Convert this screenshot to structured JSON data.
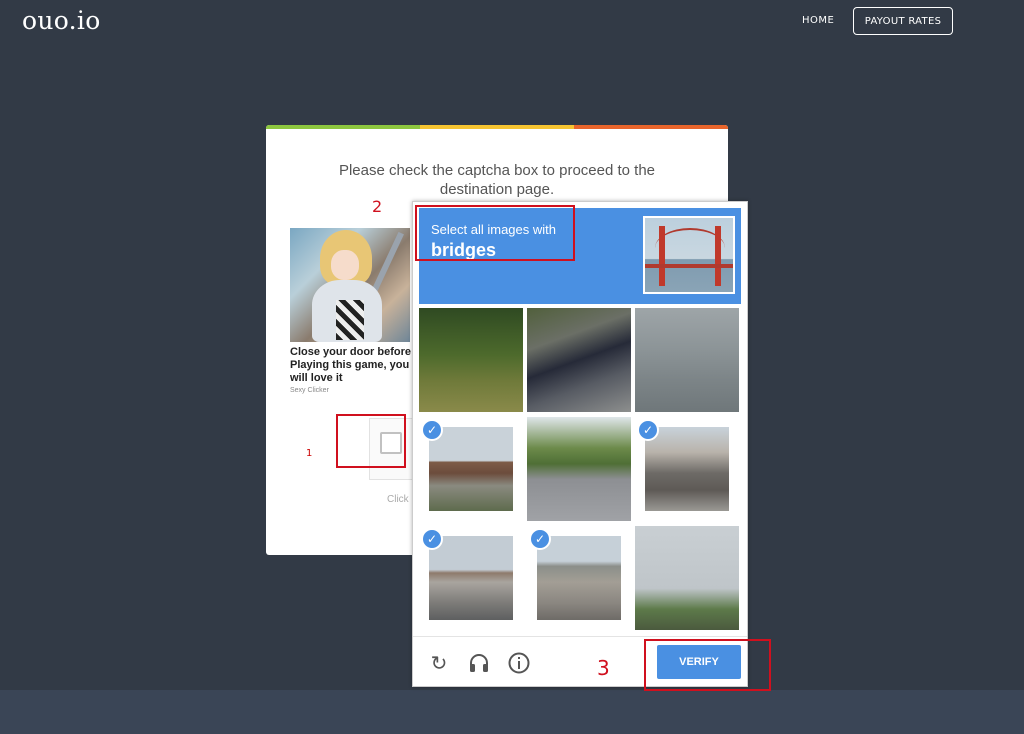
{
  "header": {
    "logo": "ouo.io",
    "nav": {
      "home": "HOME",
      "payout_rates": "PAYOUT RATES"
    }
  },
  "card": {
    "title": "Please check the captcha box to proceed to the destination page.",
    "top_bar_colors": [
      "#8dc63f",
      "#f6c431",
      "#e9652c"
    ],
    "ad": {
      "caption": "Close your door before Playing this game, you will love it",
      "source": "Sexy Clicker"
    },
    "click_hint": "Click"
  },
  "annotations": {
    "one": "1",
    "two": "2",
    "three": "3"
  },
  "captcha": {
    "prompt_prefix": "Select all images with",
    "prompt_object": "bridges",
    "tiles": [
      {
        "selected": false
      },
      {
        "selected": false
      },
      {
        "selected": false
      },
      {
        "selected": true
      },
      {
        "selected": false
      },
      {
        "selected": true
      },
      {
        "selected": true
      },
      {
        "selected": true
      },
      {
        "selected": false
      }
    ],
    "footer_icons": [
      "reload-icon",
      "headphones-icon",
      "info-icon"
    ],
    "verify_label": "VERIFY",
    "accent_color": "#4a90e2"
  }
}
